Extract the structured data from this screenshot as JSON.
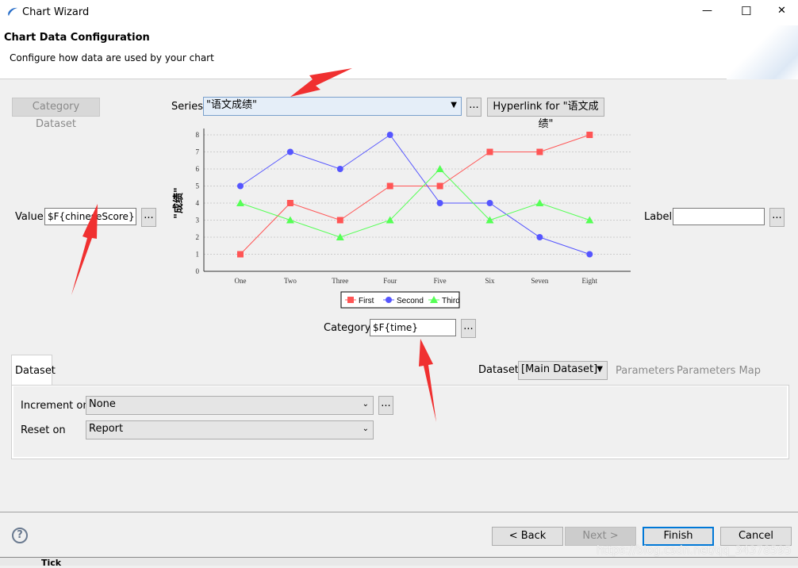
{
  "window": {
    "title": "Chart Wizard",
    "minimize": "—",
    "maximize": "☐",
    "close": "✕"
  },
  "header": {
    "title": "Chart Data Configuration",
    "subtitle": "Configure how data are used by your chart"
  },
  "category_dataset_button": "Category Dataset",
  "series": {
    "label": "Series",
    "value": "\"语文成绩\"",
    "dots": "...",
    "hyperlink": "Hyperlink for \"语文成绩\""
  },
  "value": {
    "label": "Value",
    "value": "$F{chineseScore}",
    "dots": "..."
  },
  "label_field": {
    "label": "Label",
    "value": "",
    "dots": "..."
  },
  "category": {
    "label": "Category",
    "value": "$F{time}",
    "dots": "..."
  },
  "chart_data": {
    "type": "line",
    "ylabel": "\"成绩\"",
    "ylim": [
      0,
      8
    ],
    "yticks": [
      "0",
      "1",
      "2",
      "3",
      "4",
      "5",
      "6",
      "7",
      "8"
    ],
    "categories": [
      "One",
      "Two",
      "Three",
      "Four",
      "Five",
      "Six",
      "Seven",
      "Eight"
    ],
    "grid": true,
    "legend": "bottom",
    "series": [
      {
        "name": "First",
        "color": "#ff5555",
        "marker": "square",
        "values": [
          1,
          4,
          3,
          5,
          5,
          7,
          7,
          8
        ]
      },
      {
        "name": "Second",
        "color": "#5555ff",
        "marker": "circle",
        "values": [
          5,
          7,
          6,
          8,
          4,
          4,
          2,
          1
        ]
      },
      {
        "name": "Third",
        "color": "#55ff55",
        "marker": "triangle",
        "values": [
          4,
          3,
          2,
          3,
          6,
          3,
          4,
          3
        ]
      }
    ]
  },
  "dataset_tab": {
    "tab": "Dataset",
    "dataset_label": "Dataset",
    "dataset_value": "[Main Dataset]",
    "parameters": "Parameters",
    "parameters_map": "Parameters Map",
    "increment_label": "Increment on",
    "increment_value": "None",
    "increment_dots": "...",
    "reset_label": "Reset on",
    "reset_value": "Report"
  },
  "footer": {
    "help": "?",
    "back": "< Back",
    "next": "Next >",
    "finish": "Finish",
    "cancel": "Cancel",
    "watermark": "https://blog.csdn.net/qq_34378595",
    "behind_text": "Tick"
  },
  "colors": {
    "annotation_arrow": "#f03030",
    "finish_border": "#0078d7"
  }
}
